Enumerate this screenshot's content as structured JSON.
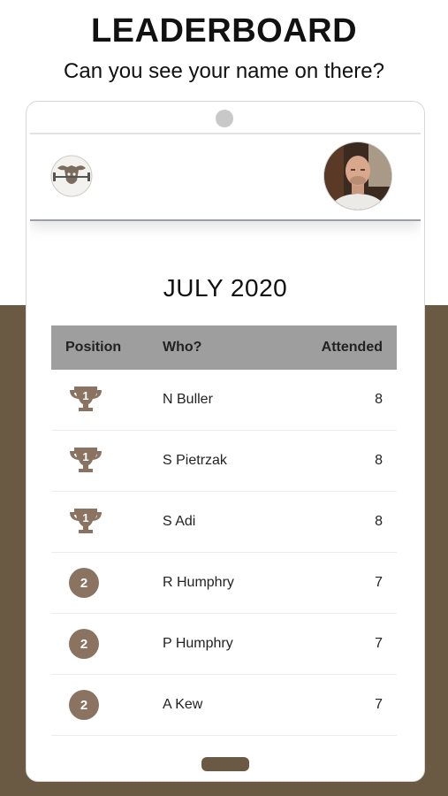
{
  "heading": {
    "title": "LEADERBOARD",
    "subtitle": "Can you see your name on there?"
  },
  "leaderboard": {
    "month": "JULY 2020",
    "columns": {
      "position": "Position",
      "who": "Who?",
      "attended": "Attended"
    },
    "rows": [
      {
        "rank": "1",
        "rank_icon": "trophy-icon",
        "name": "N Buller",
        "attended": "8"
      },
      {
        "rank": "1",
        "rank_icon": "trophy-icon",
        "name": "S Pietrzak",
        "attended": "8"
      },
      {
        "rank": "1",
        "rank_icon": "trophy-icon",
        "name": "S Adi",
        "attended": "8"
      },
      {
        "rank": "2",
        "rank_icon": "circle-badge-icon",
        "name": "R Humphry",
        "attended": "7"
      },
      {
        "rank": "2",
        "rank_icon": "circle-badge-icon",
        "name": "P Humphry",
        "attended": "7"
      },
      {
        "rank": "2",
        "rank_icon": "circle-badge-icon",
        "name": "A Kew",
        "attended": "7"
      }
    ]
  },
  "colors": {
    "brand_brown": "#6b5a43",
    "badge_brown": "#8a7461",
    "table_header_gray": "#9e9e9e"
  }
}
